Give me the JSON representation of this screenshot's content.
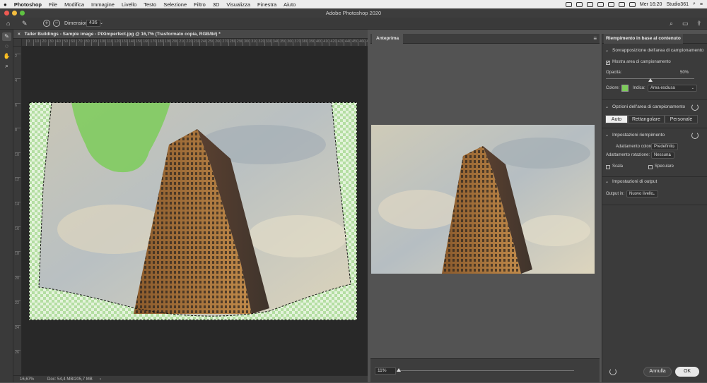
{
  "menubar": {
    "app": "Photoshop",
    "items": [
      "File",
      "Modifica",
      "Immagine",
      "Livello",
      "Testo",
      "Selezione",
      "Filtro",
      "3D",
      "Visualizza",
      "Finestra",
      "Aiuto"
    ],
    "clock": "Mer 16:20",
    "user": "Studio361"
  },
  "window": {
    "title": "Adobe Photoshop 2020"
  },
  "options": {
    "dimension_label": "Dimensioni:",
    "dimension_value": "436"
  },
  "document": {
    "tab_title": "Taller Buildings - Sample image - PiXimperfect.jpg @ 16,7% (Trasformato copia, RGB/8#) *",
    "zoom": "16,67%",
    "doc_size": "Doc: 54,4 MB/205,7 MB",
    "ruler_h": [
      "0",
      "10",
      "20",
      "30",
      "40",
      "50",
      "60",
      "70",
      "80",
      "90",
      "100",
      "110",
      "120",
      "130",
      "140",
      "150",
      "160",
      "170",
      "180",
      "190",
      "200",
      "210",
      "220",
      "230",
      "240",
      "250",
      "260",
      "270",
      "280",
      "290",
      "300",
      "310",
      "320",
      "330",
      "340",
      "350",
      "360",
      "370",
      "380",
      "390",
      "400",
      "410",
      "420",
      "430",
      "440",
      "450",
      "460",
      "470"
    ],
    "ruler_v": [
      "2",
      "4",
      "6",
      "8",
      "10",
      "12",
      "14",
      "16",
      "18",
      "20",
      "22",
      "24",
      "26"
    ]
  },
  "preview": {
    "tab": "Anteprima",
    "zoom": "11%",
    "zoom_fraction": 0.0
  },
  "panel": {
    "title": "Riempimento in base al contenuto",
    "sampling_overlay": {
      "title": "Sovrapposizione dell'area di campionamento",
      "show_label": "Mostra area di campionamento",
      "show_checked": true,
      "opacity_label": "Opacità:",
      "opacity_value": "50%",
      "opacity_fraction": 0.5,
      "color_label": "Colore:",
      "color": "#7dcc5a",
      "indicates_label": "Indica:",
      "indicates_value": "Area esclusa"
    },
    "sampling_options": {
      "title": "Opzioni dell'area di campionamento",
      "buttons": [
        "Auto",
        "Rettangolare",
        "Personale"
      ],
      "selected": "Auto"
    },
    "fill_settings": {
      "title": "Impostazioni riempimento",
      "color_adapt_label": "Adattamento colore:",
      "color_adapt_value": "Predefinito",
      "rotation_label": "Adattamento rotazione:",
      "rotation_value": "Nessuna",
      "scale_label": "Scala",
      "mirror_label": "Speculare"
    },
    "output_settings": {
      "title": "Impostazioni di output",
      "output_label": "Output in:",
      "output_value": "Nuovo livello"
    },
    "cancel": "Annulla",
    "ok": "OK"
  },
  "colors": {
    "accent_green": "#7dcc5a",
    "ps_dark": "#3b3b3b"
  }
}
